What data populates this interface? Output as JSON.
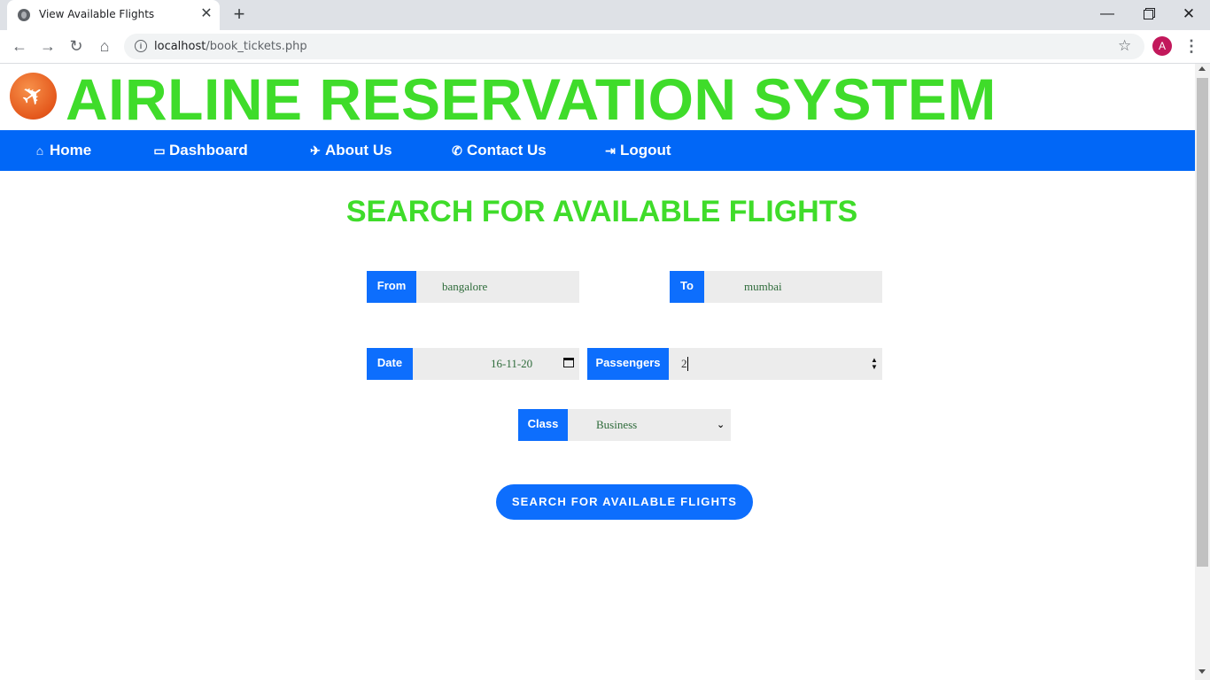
{
  "browser": {
    "tab_title": "View Available Flights",
    "url_host": "localhost",
    "url_path": "/book_tickets.php",
    "profile_initial": "A"
  },
  "site": {
    "title": "AIRLINE RESERVATION SYSTEM",
    "nav": [
      {
        "label": "Home",
        "icon": "home-icon"
      },
      {
        "label": "Dashboard",
        "icon": "monitor-icon"
      },
      {
        "label": "About Us",
        "icon": "plane-icon"
      },
      {
        "label": "Contact Us",
        "icon": "phone-icon"
      },
      {
        "label": "Logout",
        "icon": "logout-icon"
      }
    ]
  },
  "form": {
    "heading": "SEARCH FOR AVAILABLE FLIGHTS",
    "from": {
      "label": "From",
      "value": "bangalore"
    },
    "to": {
      "label": "To",
      "value": "mumbai"
    },
    "date": {
      "label": "Date",
      "value": "16-11-20"
    },
    "passengers": {
      "label": "Passengers",
      "value": "2"
    },
    "class": {
      "label": "Class",
      "value": "Business"
    },
    "submit_label": "SEARCH FOR AVAILABLE FLIGHTS"
  },
  "colors": {
    "title_green": "#3fdc2a",
    "nav_blue": "#0167f7",
    "button_blue": "#0d6efd"
  }
}
